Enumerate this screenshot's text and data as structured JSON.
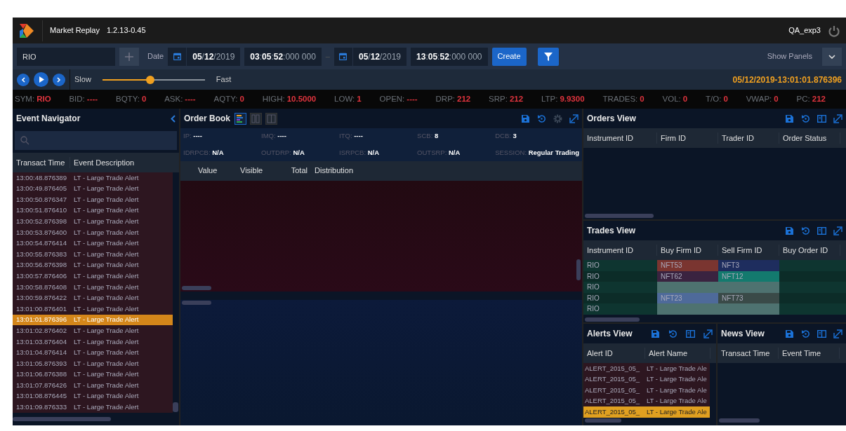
{
  "app": {
    "title": "Market Replay",
    "version": "1.2.13-0.45",
    "user": "QA_exp3"
  },
  "toolbar": {
    "symbol": "RIO",
    "date_label": "Date",
    "start_date": "**05**/**12**/2019",
    "start_time": "**03**:**05**:**52**:000 000",
    "separator": "–",
    "end_date": "**05**/**12**/2019",
    "end_time": "**13**:**05**:**52**:000 000",
    "create": "Create",
    "show_panels": "Show Panels"
  },
  "replay": {
    "slow": "Slow",
    "fast": "Fast",
    "level": 0.47,
    "timestamp": "05/12/2019-13:01:01.876396"
  },
  "stats": [
    {
      "label": "SYM:",
      "value": "RIO"
    },
    {
      "label": "BID:",
      "value": "----"
    },
    {
      "label": "BQTY:",
      "value": "0"
    },
    {
      "label": "ASK:",
      "value": "----"
    },
    {
      "label": "AQTY:",
      "value": "0"
    },
    {
      "label": "HIGH:",
      "value": "10.5000"
    },
    {
      "label": "LOW:",
      "value": "1"
    },
    {
      "label": "OPEN:",
      "value": "----"
    },
    {
      "label": "DRP:",
      "value": "212"
    },
    {
      "label": "SRP:",
      "value": "212"
    },
    {
      "label": "LTP:",
      "value": "9.9300"
    },
    {
      "label": "TRADES:",
      "value": "0"
    },
    {
      "label": "VOL:",
      "value": "0"
    },
    {
      "label": "T/O:",
      "value": "0"
    },
    {
      "label": "VWAP:",
      "value": "0"
    },
    {
      "label": "PC:",
      "value": "212"
    }
  ],
  "event_navigator": {
    "title": "Event Navigator",
    "columns": [
      "Transact Time",
      "Event Description"
    ],
    "rows": [
      {
        "time": "13:00:48.876389",
        "description": "LT - Large Trade Alert",
        "selected": false
      },
      {
        "time": "13:00:49.876405",
        "description": "LT - Large Trade Alert",
        "selected": false
      },
      {
        "time": "13:00:50.876347",
        "description": "LT - Large Trade Alert",
        "selected": false
      },
      {
        "time": "13:00:51.876410",
        "description": "LT - Large Trade Alert",
        "selected": false
      },
      {
        "time": "13:00:52.876398",
        "description": "LT - Large Trade Alert",
        "selected": false
      },
      {
        "time": "13:00:53.876400",
        "description": "LT - Large Trade Alert",
        "selected": false
      },
      {
        "time": "13:00:54.876414",
        "description": "LT - Large Trade Alert",
        "selected": false
      },
      {
        "time": "13:00:55.876383",
        "description": "LT - Large Trade Alert",
        "selected": false
      },
      {
        "time": "13:00:56.876398",
        "description": "LT - Large Trade Alert",
        "selected": false
      },
      {
        "time": "13:00:57.876406",
        "description": "LT - Large Trade Alert",
        "selected": false
      },
      {
        "time": "13:00:58.876408",
        "description": "LT - Large Trade Alert",
        "selected": false
      },
      {
        "time": "13:00:59.876422",
        "description": "LT - Large Trade Alert",
        "selected": false
      },
      {
        "time": "13:01:00.876401",
        "description": "LT - Large Trade Alert",
        "selected": false
      },
      {
        "time": "13:01:01.876396",
        "description": "LT - Large Trade Alert",
        "selected": true
      },
      {
        "time": "13:01:02.876402",
        "description": "LT - Large Trade Alert",
        "selected": false
      },
      {
        "time": "13:01:03.876404",
        "description": "LT - Large Trade Alert",
        "selected": false
      },
      {
        "time": "13:01:04.876414",
        "description": "LT - Large Trade Alert",
        "selected": false
      },
      {
        "time": "13:01:05.876393",
        "description": "LT - Large Trade Alert",
        "selected": false
      },
      {
        "time": "13:01:06.876388",
        "description": "LT - Large Trade Alert",
        "selected": false
      },
      {
        "time": "13:01:07.876426",
        "description": "LT - Large Trade Alert",
        "selected": false
      },
      {
        "time": "13:01:08.876445",
        "description": "LT - Large Trade Alert",
        "selected": false
      },
      {
        "time": "13:01:09.876333",
        "description": "LT - Large Trade Alert",
        "selected": false
      }
    ]
  },
  "order_book": {
    "title": "Order Book",
    "view_toggles": [
      {
        "selected": true
      },
      {
        "selected": false
      },
      {
        "selected": false
      }
    ],
    "tools": [
      {
        "kind": "save",
        "disabled": false
      },
      {
        "kind": "reset",
        "disabled": false
      },
      {
        "kind": "settings",
        "disabled": true
      },
      {
        "kind": "expand",
        "disabled": false
      }
    ],
    "info": [
      [
        {
          "label": "IP:",
          "value": "----"
        },
        {
          "label": "IMQ:",
          "value": "----"
        },
        {
          "label": "ITQ:",
          "value": "----"
        },
        {
          "label": "SCB:",
          "value": "8"
        },
        {
          "label": "DCB:",
          "value": "3"
        }
      ],
      [
        {
          "label": "IDRPCB:",
          "value": "N/A"
        },
        {
          "label": "OUTDRP:",
          "value": "N/A"
        },
        {
          "label": "ISRPCB:",
          "value": "N/A"
        },
        {
          "label": "OUTSRP:",
          "value": "N/A"
        },
        {
          "label": "SESSION:",
          "value": "Regular Trading"
        }
      ]
    ],
    "columns": [
      "Value",
      "Visible",
      "Total",
      "Distribution"
    ]
  },
  "orders_view": {
    "title": "Orders View",
    "columns": [
      "Instrument ID",
      "Firm ID",
      "Trader ID",
      "Order Status"
    ]
  },
  "trades_view": {
    "title": "Trades View",
    "columns": [
      "Instrument ID",
      "Buy Firm ID",
      "Sell Firm ID",
      "Buy Order ID"
    ],
    "rows": [
      {
        "instrument": "RIO",
        "buy": {
          "text": "NFT53",
          "color": "#7a3530"
        },
        "sell": {
          "text": "NFT3",
          "color": "#1e2d5e"
        }
      },
      {
        "instrument": "RIO",
        "buy": {
          "text": "NFT62",
          "color": "#3a2340"
        },
        "sell": {
          "text": "NFT12",
          "color": "#137a6e"
        }
      },
      {
        "instrument": "RIO",
        "buy": {
          "color": "#4e7270"
        },
        "sell": {
          "color": "#4e7270"
        }
      },
      {
        "instrument": "RIO",
        "buy": {
          "text": "NFT23",
          "color": "#4e6a9a"
        },
        "sell": {
          "text": "NFT73",
          "color": "#3a4a48"
        }
      },
      {
        "instrument": "RIO",
        "buy": {
          "color": "#4e7270"
        },
        "sell": {
          "color": "#4e7270"
        }
      }
    ]
  },
  "alerts_view": {
    "title": "Alerts View",
    "columns": [
      "Alert ID",
      "Alert Name"
    ],
    "rows": [
      {
        "id": "ALERT_2015_05_",
        "name": "LT - Large Trade Ale",
        "selected": false
      },
      {
        "id": "ALERT_2015_05_",
        "name": "LT - Large Trade Ale",
        "selected": false
      },
      {
        "id": "ALERT_2015_05_",
        "name": "LT - Large Trade Ale",
        "selected": false
      },
      {
        "id": "ALERT_2015_05_",
        "name": "LT - Large Trade Ale",
        "selected": false
      },
      {
        "id": "ALERT_2015_05_",
        "name": "LT - Large Trade Ale",
        "selected": true
      }
    ]
  },
  "news_view": {
    "title": "News View",
    "columns": [
      "Transact Time",
      "Event Time"
    ]
  }
}
